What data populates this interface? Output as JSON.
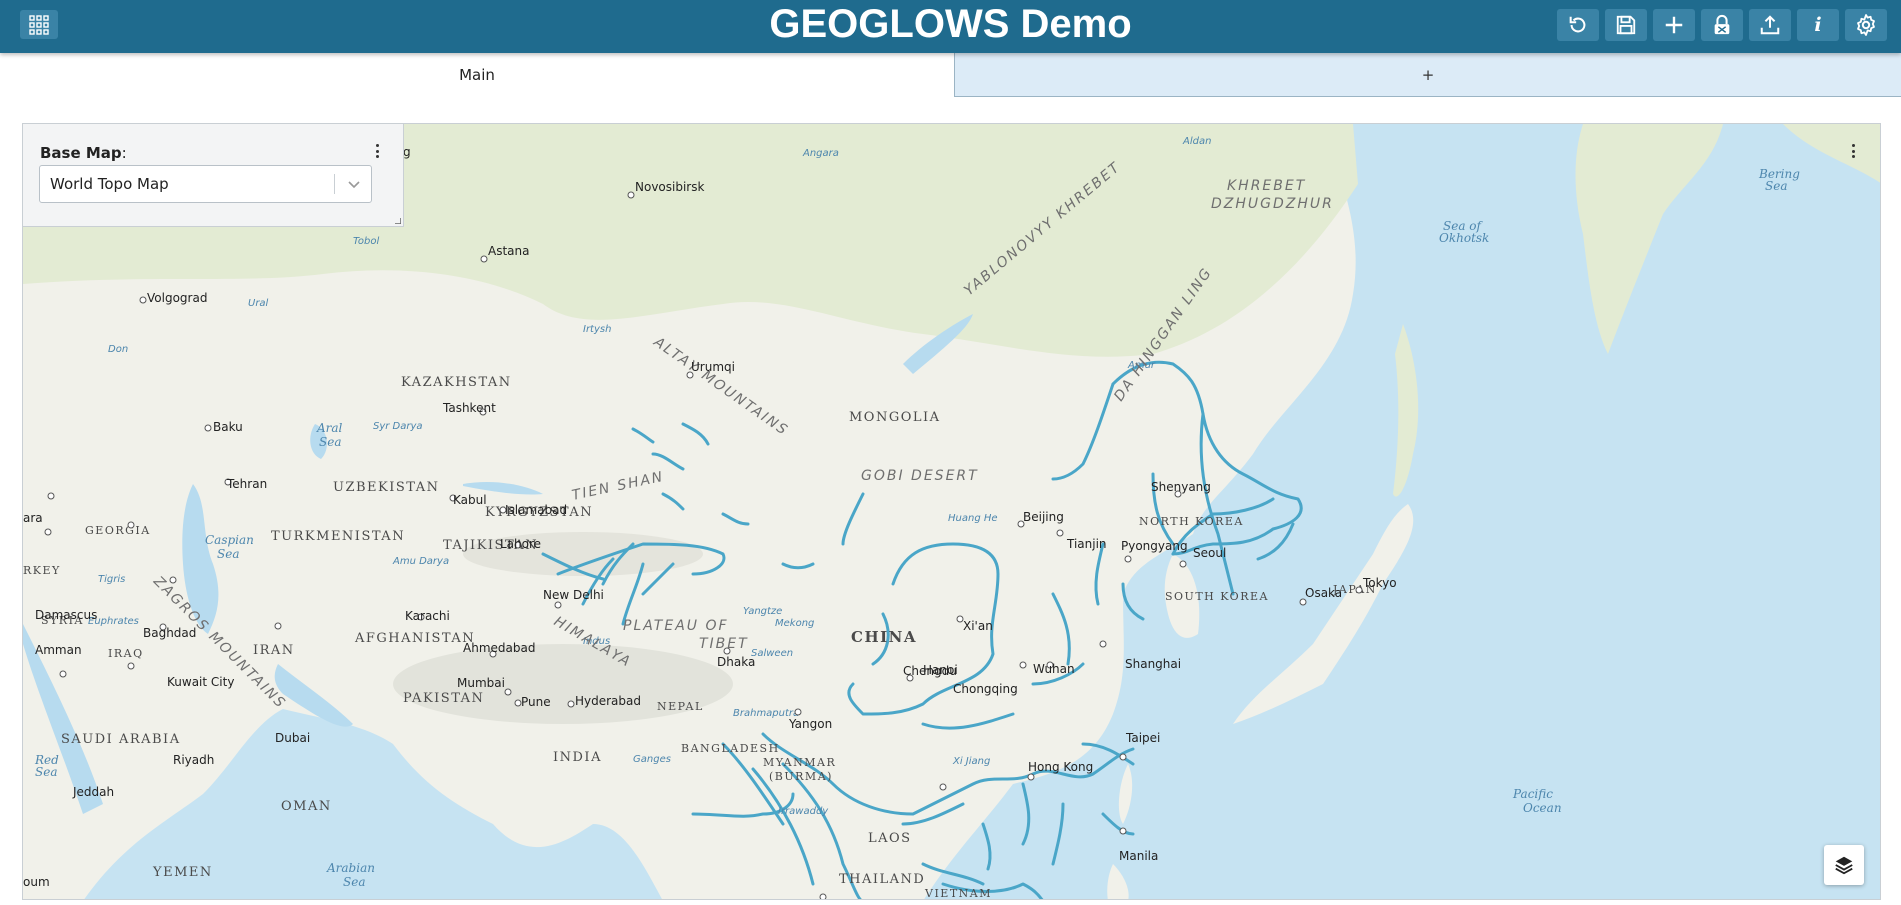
{
  "header": {
    "title": "GEOGLOWS Demo",
    "apps_icon": "grid-icon",
    "toolbar": [
      {
        "name": "reset",
        "icon": "refresh-icon"
      },
      {
        "name": "save",
        "icon": "save-icon"
      },
      {
        "name": "add",
        "icon": "plus-icon"
      },
      {
        "name": "lock",
        "icon": "lock-icon"
      },
      {
        "name": "export",
        "icon": "upload-icon"
      },
      {
        "name": "info",
        "icon": "info-icon",
        "glyph": "i"
      },
      {
        "name": "settings",
        "icon": "gear-icon"
      }
    ]
  },
  "tabs": {
    "main_label": "Main",
    "add_label": "+"
  },
  "map": {
    "basemap_label": "Base Map",
    "basemap_colon": ":",
    "basemap_value": "World Topo Map",
    "countries": [
      "KAZAKHSTAN",
      "MONGOLIA",
      "CHINA",
      "UZBEKISTAN",
      "TURKMENISTAN",
      "TAJIKISTAN",
      "KYRGYZSTAN",
      "AFGHANISTAN",
      "PAKISTAN",
      "INDIA",
      "NEPAL",
      "BANGLADESH",
      "MYANMAR",
      "(BURMA)",
      "LAOS",
      "THAILAND",
      "VIETNAM",
      "IRAN",
      "IRAQ",
      "SYRIA",
      "GEORGIA",
      "RKEY",
      "SAUDI ARABIA",
      "OMAN",
      "YEMEN",
      "NORTH KOREA",
      "SOUTH KOREA",
      "JAPAN"
    ],
    "cities": [
      "Novosibirsk",
      "Astana",
      "Volgograd",
      "Urumqi",
      "Tashkent",
      "Baku",
      "Tehran",
      "Kabul",
      "Islamabad",
      "Lahore",
      "New Delhi",
      "Karachi",
      "Ahmedabad",
      "Mumbai",
      "Pune",
      "Hyderabad",
      "Dhaka",
      "Yangon",
      "Hanoi",
      "Hong Kong",
      "Taipei",
      "Manila",
      "Shanghai",
      "Wuhan",
      "Chengdu",
      "Chongqing",
      "Xi'an",
      "Beijing",
      "Tianjin",
      "Pyongyang",
      "Seoul",
      "Shenyang",
      "Osaka",
      "Tokyo",
      "Damascus",
      "Amman",
      "Baghdad",
      "Kuwait City",
      "Riyadh",
      "Jeddah",
      "Dubai",
      "burg",
      "ara",
      "oum"
    ],
    "physical": [
      "ALTAY MOUNTAINS",
      "GOBI DESERT",
      "PLATEAU OF",
      "TIBET",
      "HIMALAYA",
      "ZAGROS MOUNTAINS",
      "YABLONOVYY KHREBET",
      "DA HINGGAN LING",
      "KHREBET",
      "DZHUGDZHUR",
      "TIEN SHAN"
    ],
    "water": [
      "Caspian",
      "Sea",
      "Aral",
      "Sea",
      "Sea of",
      "Okhotsk",
      "Bering",
      "Sea",
      "Pacific",
      "Ocean",
      "Arabian",
      "Sea",
      "Red",
      "Sea"
    ],
    "rivers": [
      "Angara",
      "Aldan",
      "Amur",
      "Ural",
      "Don",
      "Tobol",
      "Irtysh",
      "Syr Darya",
      "Amu Darya",
      "Indus",
      "Ganges",
      "Brahmaputra",
      "Yangtze",
      "Mekong",
      "Salween",
      "Huang He",
      "Xi Jiang",
      "Irrawaddy",
      "Euphrates",
      "Tigris"
    ]
  }
}
